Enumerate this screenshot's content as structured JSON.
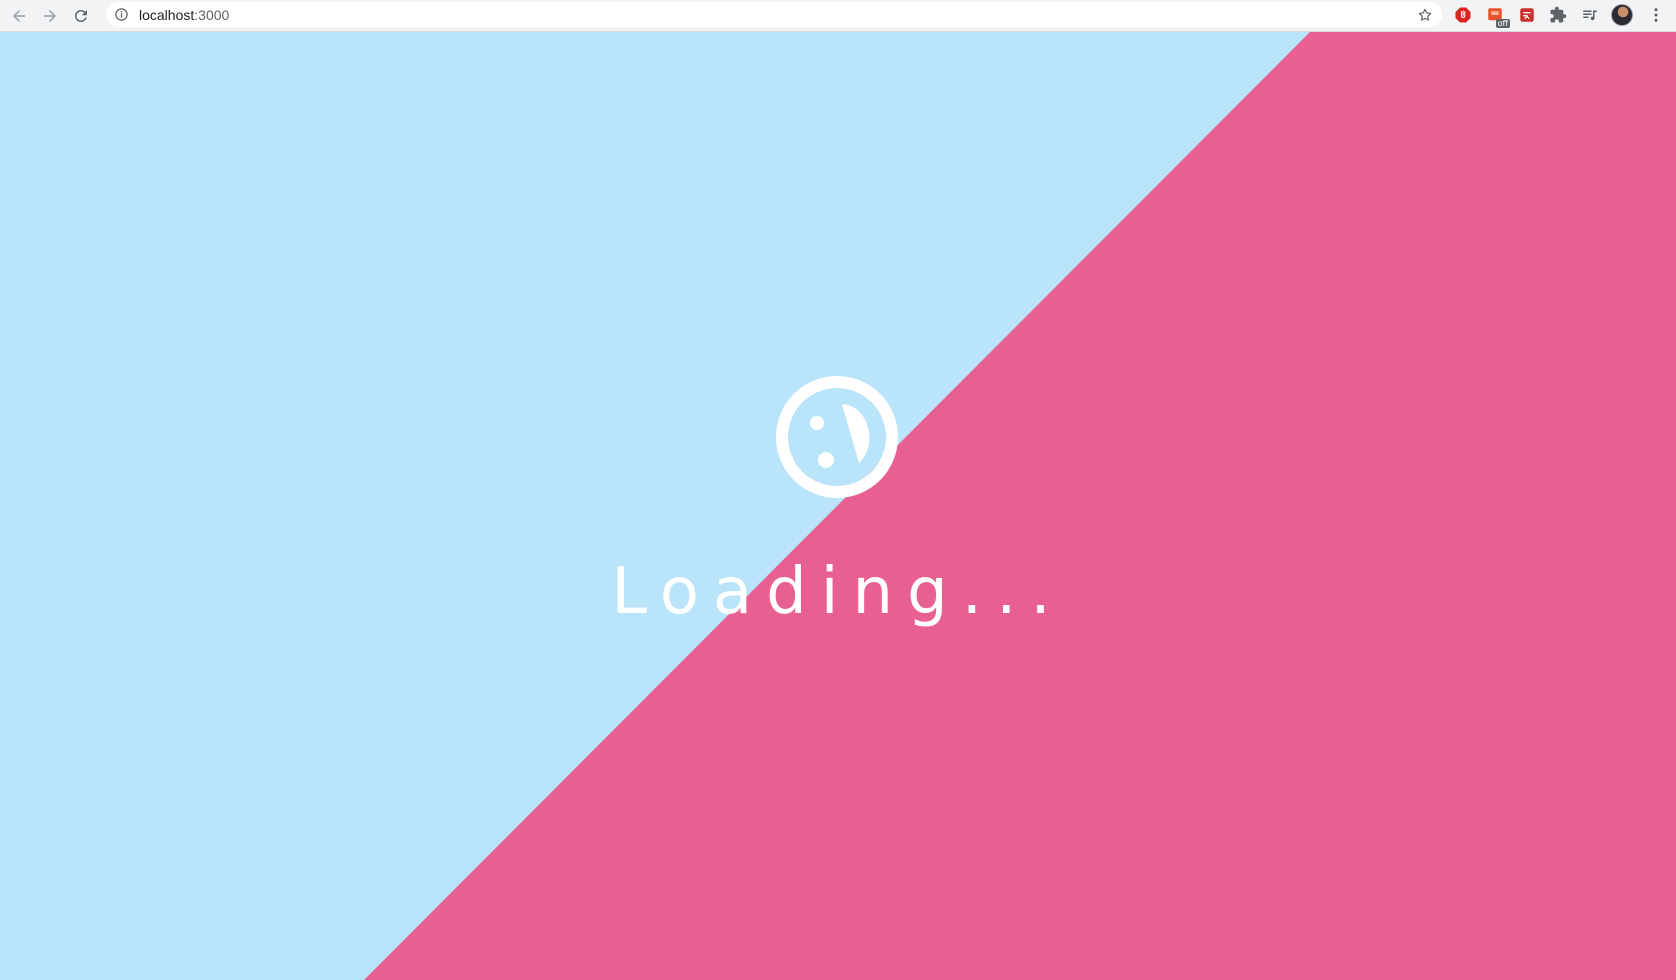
{
  "browser": {
    "url_host": "localhost",
    "url_port": ":3000",
    "extensions": [
      {
        "name": "adblock-icon",
        "badge": ""
      },
      {
        "name": "extension-off-icon",
        "badge": "off"
      },
      {
        "name": "extension-red-icon",
        "badge": ""
      }
    ]
  },
  "page": {
    "loading_text": "Loading...",
    "colors": {
      "left_bg": "#b9e4fa",
      "right_bg": "#e85f92",
      "foreground": "#ffffff"
    }
  }
}
